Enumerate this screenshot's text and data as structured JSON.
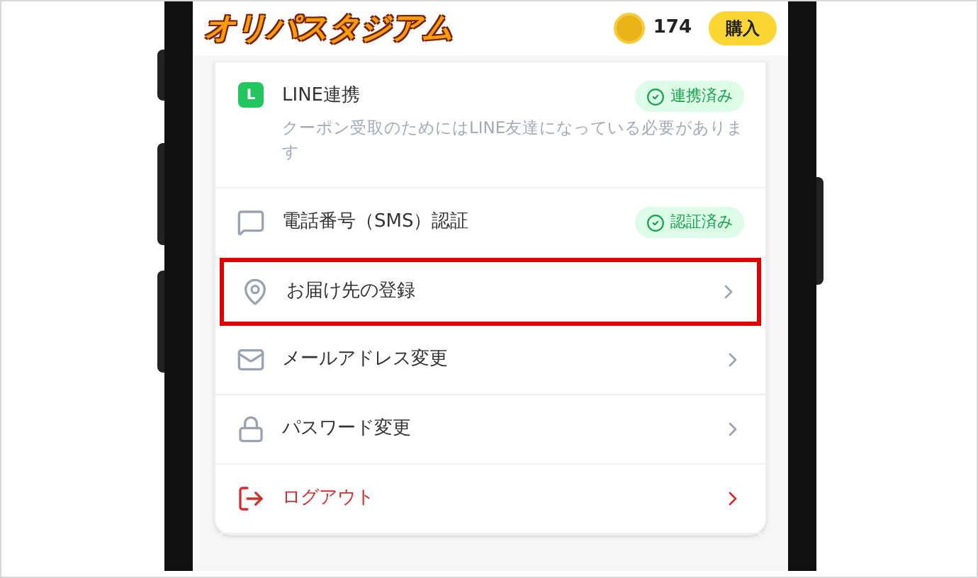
{
  "header": {
    "logo": "オリパスタジアム",
    "coins": "174",
    "buy_button": "購入"
  },
  "items": [
    {
      "kind": "badge",
      "icon_letter": "L",
      "label": "LINE連携",
      "badge": "連携済み",
      "description": "クーポン受取のためにはLINE友達になっている必要があります",
      "highlighted": false
    },
    {
      "kind": "badge",
      "label": "電話番号（SMS）認証",
      "badge": "認証済み",
      "highlighted": false
    },
    {
      "kind": "link",
      "label": "お届け先の登録",
      "highlighted": true
    },
    {
      "kind": "link",
      "label": "メールアドレス変更",
      "highlighted": false
    },
    {
      "kind": "link",
      "label": "パスワード変更",
      "highlighted": false
    },
    {
      "kind": "danger",
      "label": "ログアウト",
      "highlighted": false
    }
  ]
}
